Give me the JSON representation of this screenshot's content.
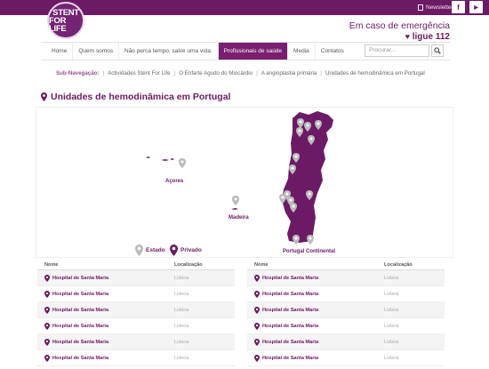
{
  "header": {
    "logo_line1": "STENT",
    "logo_line2": "FOR LIFE",
    "newsletter": "Newsletter",
    "social_facebook": "f",
    "social_youtube": "▶",
    "emergency_line1": "Em caso de emergência",
    "emergency_line2": "ligue 112"
  },
  "nav": {
    "items": [
      "Home",
      "Quem somos",
      "Não perca tempo, salve uma vida.",
      "Profissionais de saúde",
      "Media",
      "Contatos"
    ],
    "active_index": 3,
    "search_placeholder": "Procurar..."
  },
  "subnav": {
    "label": "Sub-Navegação:",
    "items": [
      "Actividades Stent For Life",
      "O Enfarte Agudo do Miocárdio",
      "A angioplastia primária",
      "Unidades de hemodinâmica em Portugal"
    ]
  },
  "page": {
    "title": "Unidades de hemodinâmica em Portugal"
  },
  "map": {
    "label_azores": "Açores",
    "label_madeira": "Madeira",
    "label_continental": "Portugal Continental",
    "legend_public": "Estado",
    "legend_private": "Privado",
    "colors": {
      "land": "#6d1a66",
      "pin_public": "#bbbbbb",
      "pin_private": "#6d1a66"
    }
  },
  "tables": [
    {
      "headers": [
        "Nome",
        "Localização"
      ],
      "rows": [
        {
          "name": "Hospital de Santa Maria",
          "location": "Lisboa"
        },
        {
          "name": "Hospital de Santa Maria",
          "location": "Lisboa"
        },
        {
          "name": "Hospital de Santa Maria",
          "location": "Lisboa"
        },
        {
          "name": "Hospital de Santa Maria",
          "location": "Lisboa"
        },
        {
          "name": "Hospital de Santa Maria",
          "location": "Lisboa"
        },
        {
          "name": "Hospital de Santa Maria",
          "location": "Lisboa"
        }
      ]
    },
    {
      "headers": [
        "Nome",
        "Localização"
      ],
      "rows": [
        {
          "name": "Hospital de Santa Maria",
          "location": "Lisboa"
        },
        {
          "name": "Hospital de Santa Maria",
          "location": "Lisboa"
        },
        {
          "name": "Hospital de Santa Maria",
          "location": "Lisboa"
        },
        {
          "name": "Hospital de Santa Maria",
          "location": "Lisboa"
        },
        {
          "name": "Hospital de Santa Maria",
          "location": "Lisboa"
        },
        {
          "name": "Hospital de Santa Maria",
          "location": "Lisboa"
        }
      ]
    }
  ]
}
